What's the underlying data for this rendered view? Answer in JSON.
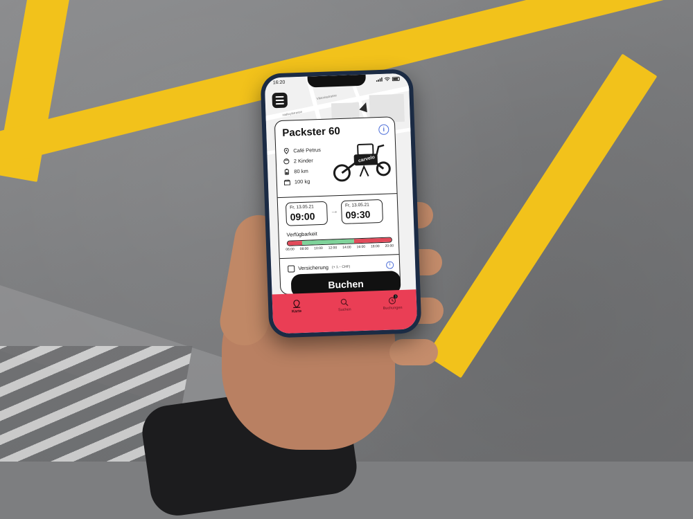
{
  "status_bar": {
    "time": "16:20"
  },
  "card": {
    "title": "Packster 60",
    "specs": [
      {
        "icon": "location-pin-icon",
        "text": "Café Petrus"
      },
      {
        "icon": "child-icon",
        "text": "2 Kinder"
      },
      {
        "icon": "battery-icon",
        "text": "80 km"
      },
      {
        "icon": "weight-box-icon",
        "text": "100 kg"
      }
    ],
    "bike_brand": "carvelo",
    "start": {
      "date": "Fr, 13.05.21",
      "time": "09:00"
    },
    "end": {
      "date": "Fr, 13.05.21",
      "time": "09:30"
    },
    "availability": {
      "label": "Verfügbarkeit",
      "ticks": [
        "06:00",
        "08:00",
        "10:00",
        "12:00",
        "14:00",
        "16:00",
        "18:00",
        "20:00"
      ],
      "segments": [
        {
          "state": "unavailable",
          "from": "06:00",
          "to": "08:00",
          "color": "#e24a5a"
        },
        {
          "state": "available",
          "from": "08:00",
          "to": "15:00",
          "color": "#7fd39a"
        },
        {
          "state": "unavailable",
          "from": "15:00",
          "to": "20:00",
          "color": "#e24a5a"
        }
      ]
    },
    "insurance": {
      "label": "Versicherung",
      "price": "(+ 1.– CHF)",
      "checked": false
    }
  },
  "book_button": {
    "label": "Buchen"
  },
  "tabbar": {
    "accent": "#ea3e55",
    "tabs": [
      {
        "label": "Karte",
        "icon": "map-pin-icon",
        "active": true
      },
      {
        "label": "Suchen",
        "icon": "search-icon",
        "active": false
      },
      {
        "label": "Buchungen",
        "icon": "clock-icon",
        "active": false,
        "badge": "1"
      }
    ]
  },
  "map": {
    "streets": [
      "Viktoriastrasse",
      "Hallwylstrasse"
    ]
  }
}
